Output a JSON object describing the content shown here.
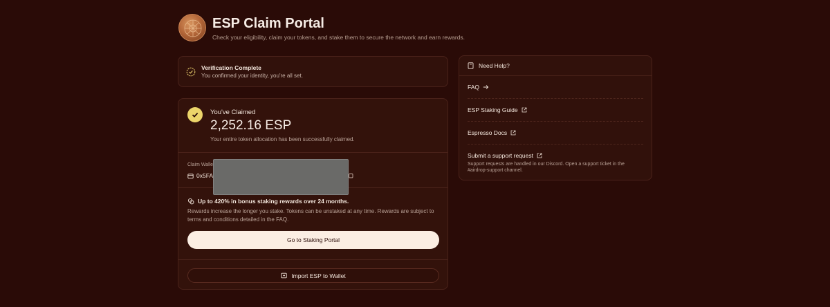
{
  "header": {
    "title": "ESP Claim Portal",
    "subtitle": "Check your eligibility, claim your tokens, and stake them to secure the network and earn rewards."
  },
  "verification": {
    "title": "Verification Complete",
    "subtitle": "You confirmed your identity, you're all set."
  },
  "claim": {
    "label": "You've Claimed",
    "amount": "2,252.16 ESP",
    "description": "Your entire token allocation has been successfully claimed.",
    "wallet_label": "Claim Walle",
    "wallet_address": "0x5FA"
  },
  "bonus": {
    "title": "Up to 420% in bonus staking rewards over 24 months.",
    "description": "Rewards increase the longer you stake. Tokens can be unstaked at any time. Rewards are subject to terms and conditions detailed in the FAQ.",
    "staking_button": "Go to Staking Portal",
    "import_button": "Import ESP to Wallet"
  },
  "help": {
    "title": "Need Help?",
    "faq": "FAQ",
    "staking_guide": "ESP Staking Guide",
    "espresso_docs": "Espresso Docs",
    "support_title": "Submit a support request",
    "support_desc": "Support requests are handled in our Discord. Open a support ticket in the #airdrop-support channel."
  },
  "colors": {
    "background": "#2a0b07",
    "accent_check": "#ecd56a",
    "button_light": "#fbeee3"
  }
}
